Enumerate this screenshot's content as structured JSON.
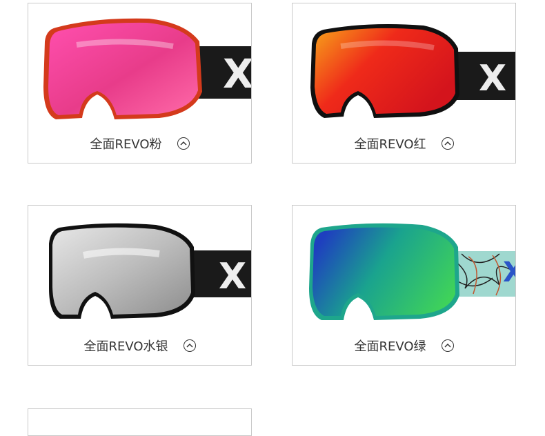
{
  "cards": [
    {
      "label": "全面REVO粉",
      "strap_text": "X",
      "colors": {
        "lens_a": "#ff4fae",
        "lens_b": "#e83c8a",
        "lens_c": "#ff6aa8",
        "frame": "#d43a1c",
        "strap": "#1a1a1a"
      }
    },
    {
      "label": "全面REVO红",
      "strap_text": "X",
      "colors": {
        "lens_a": "#f7a21a",
        "lens_b": "#ef2a1a",
        "lens_c": "#d4141c",
        "frame": "#101010",
        "strap": "#1a1a1a"
      }
    },
    {
      "label": "全面REVO水银",
      "strap_text": "X",
      "colors": {
        "lens_a": "#e6e6e6",
        "lens_b": "#bdbdbd",
        "lens_c": "#8e8e8e",
        "frame": "#111111",
        "strap": "#1a1a1a"
      }
    },
    {
      "label": "全面REVO绿",
      "strap_text": "X",
      "colors": {
        "lens_a": "#1e3fbf",
        "lens_b": "#1aa38e",
        "lens_c": "#3fd25a",
        "frame": "#1ea68c",
        "strap": "#9fd8cf"
      }
    }
  ],
  "icons": {
    "expand": "chevron-up-circle-icon"
  }
}
